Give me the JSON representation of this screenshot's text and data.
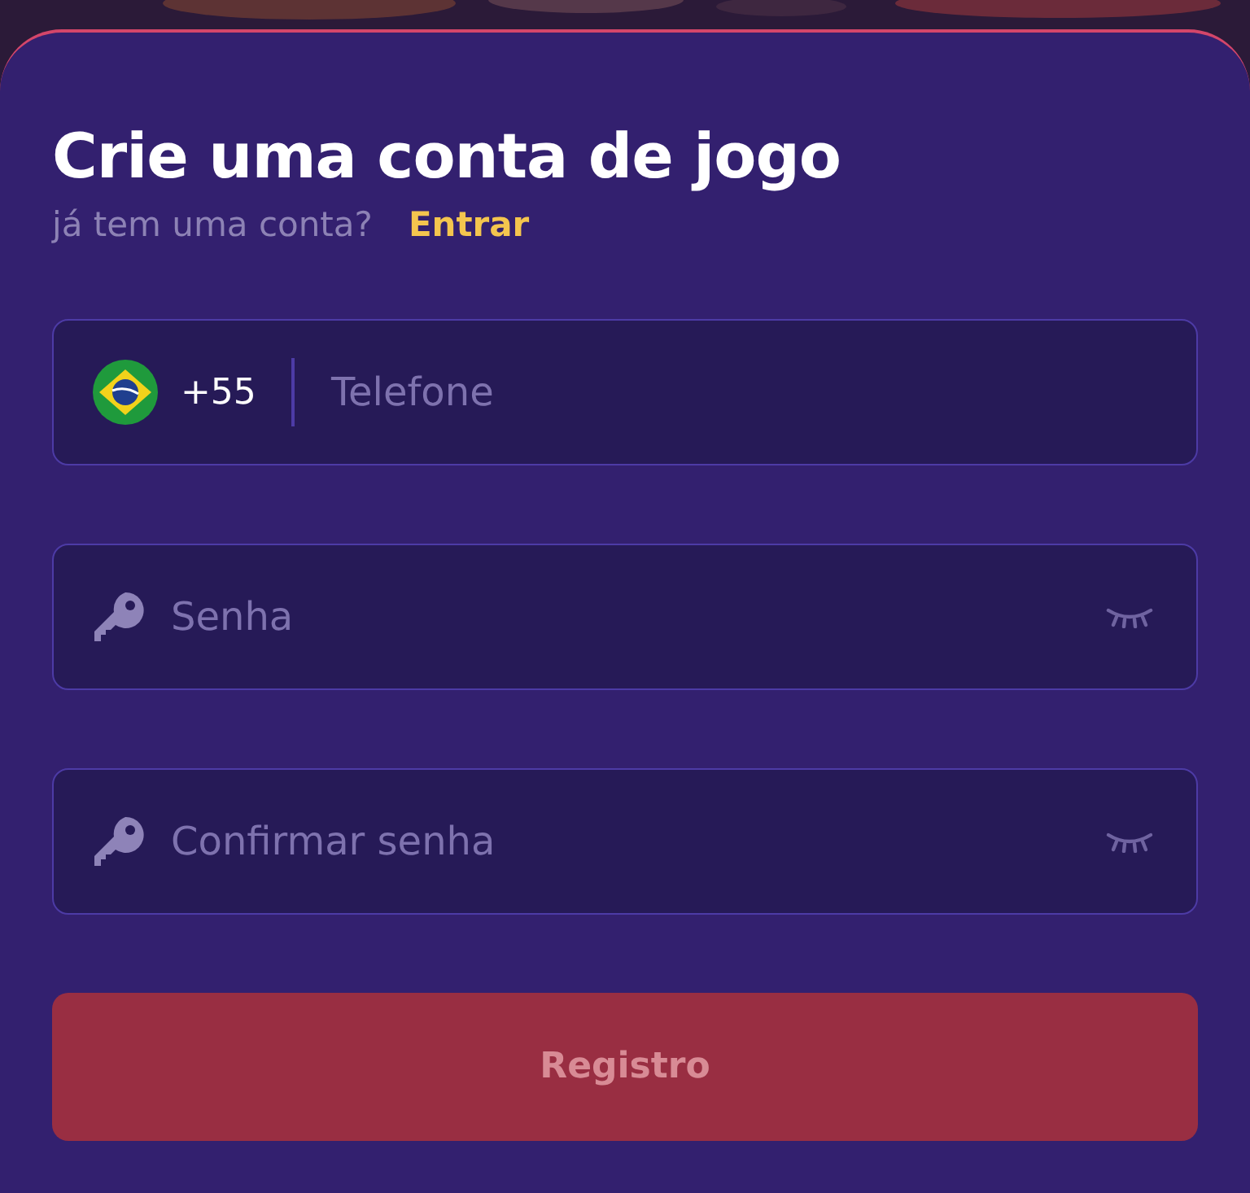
{
  "title": "Crie uma conta de jogo",
  "login_prompt": {
    "text": "já tem uma conta?",
    "link": "Entrar"
  },
  "fields": [
    {
      "kind": "phone",
      "country_code": "+55",
      "placeholder": "Telefone"
    },
    {
      "kind": "password",
      "placeholder": "Senha"
    },
    {
      "kind": "password",
      "placeholder": "Confirmar senha"
    }
  ],
  "submit": {
    "label": "Registro",
    "disabled": true
  }
}
